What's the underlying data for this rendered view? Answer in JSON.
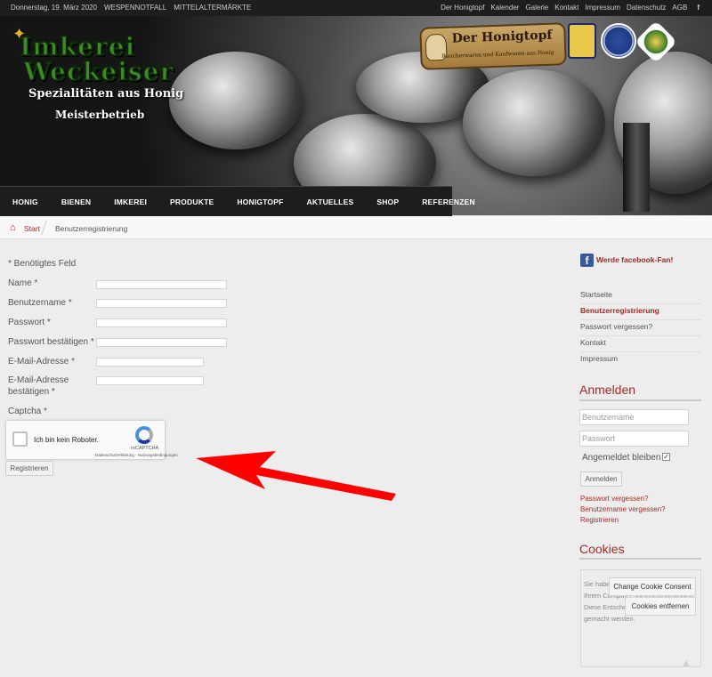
{
  "topbar": {
    "date": "Donnerstag, 19. März 2020",
    "links_left": [
      "WESPENNOTFALL",
      "MITTELALTERMÄRKTE"
    ],
    "links_right": [
      "Der Honigtopf",
      "Kalender",
      "Galerie",
      "Kontakt",
      "Impressum",
      "Datenschutz",
      "AGB"
    ],
    "facebook_icon": "f"
  },
  "header": {
    "logo_line1": "Imkerei",
    "logo_line2": "Weckeiser",
    "slogan": "Spezialitäten aus Honig",
    "subtitle": "Meisterbetrieb",
    "honigtopf_title": "Der Honigtopf",
    "honigtopf_sub": "Raucherwaren und Kaufwaren aus Honig"
  },
  "nav": [
    "HONIG",
    "BIENEN",
    "IMKEREI",
    "PRODUKTE",
    "HONIGTOPF",
    "AKTUELLES",
    "SHOP",
    "REFERENZEN"
  ],
  "breadcrumb": {
    "home_icon": "⌂",
    "start": "Start",
    "current": "Benutzerregistrierung"
  },
  "form": {
    "required_note": "* Benötigtes Feld",
    "name_label": "Name *",
    "username_label": "Benutzername *",
    "password_label": "Passwort *",
    "password_confirm_label": "Passwort bestätigen *",
    "email_label": "E-Mail-Adresse *",
    "email_confirm_label_1": "E-Mail-Adresse",
    "email_confirm_label_2": "bestätigen *",
    "captcha_label": "Captcha *",
    "captcha_text": "Ich bin kein Roboter.",
    "recaptcha_brand": "reCAPTCHA",
    "recaptcha_links": "Datenschutzerklärung - Nutzungsbedingungen",
    "register_button": "Registrieren"
  },
  "sidebar": {
    "facebook_link": "Werde facebook-Fan!",
    "menu": [
      "Startseite",
      "Benutzerregistrierung",
      "Passwort vergessen?",
      "Kontakt",
      "Impressum"
    ],
    "login_heading": "Anmelden",
    "username_placeholder": "Benutzername",
    "password_placeholder": "Passwort",
    "remember_label": "Angemeldet bleiben",
    "remember_checked": "✓",
    "login_button": "Anmelden",
    "links": [
      "Passwort vergessen?",
      "Benutzername vergessen?",
      "Registrieren"
    ],
    "cookies_heading": "Cookies",
    "cookie_text": "Sie haben zugestimmt, Cookies auf Ihrem Computer speichern zu lassen. Diese Entscheidung kann rückgängig gemacht werden.",
    "cookie_buttons": [
      "Change Cookie Consent",
      "Cookies entfernen"
    ]
  },
  "colors": {
    "accent": "#9e2b25",
    "nav_bg": "#1d1d1d",
    "arrow": "#ff0000"
  }
}
